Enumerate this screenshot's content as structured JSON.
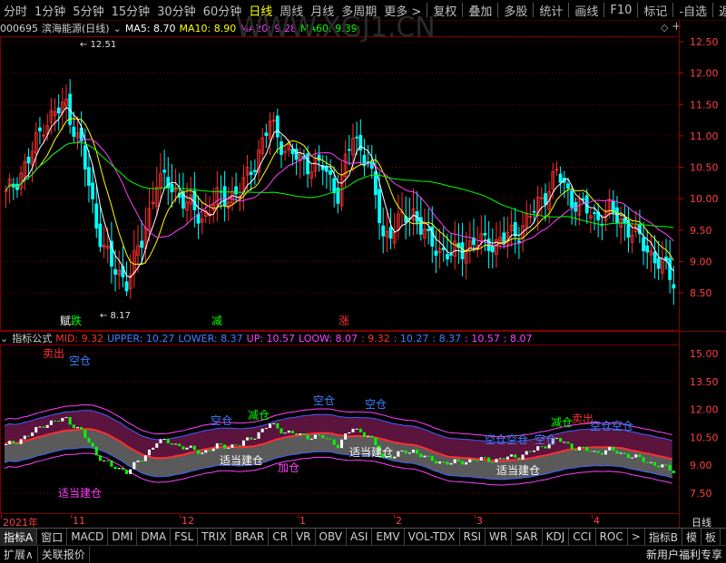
{
  "toolbar": {
    "periods": [
      "分时",
      "1分钟",
      "5分钟",
      "15分钟",
      "30分钟",
      "60分钟",
      "日线",
      "周线",
      "月线",
      "多周期",
      "更多 >"
    ],
    "active_period": "日线",
    "right_items": [
      "复权",
      "叠加",
      "多股",
      "统计",
      "画线",
      "F10",
      "标记",
      "-自选",
      "返回"
    ]
  },
  "stock": {
    "code": "000695",
    "name": "滨海能源(日线)",
    "ma5": "MA5: 8.70",
    "ma10": "MA10: 8.90",
    "ma20": "MA20: 9.28",
    "ma60": "MA60: 9.39",
    "watermark": "WWW.XGJ1.CN"
  },
  "main_axis": {
    "ticks": [
      "12.50",
      "12.00",
      "11.50",
      "11.00",
      "10.50",
      "10.00",
      "9.50",
      "9.00",
      "8.50"
    ],
    "high_mark": "12.51",
    "low_mark": "8.17"
  },
  "main_signals": [
    {
      "text": "赋",
      "color": "#ffffff"
    },
    {
      "text": "跌",
      "color": "#00ff00"
    },
    {
      "text": "减",
      "color": "#00ff00"
    },
    {
      "text": "涨",
      "color": "#ff3030"
    }
  ],
  "indicator": {
    "name": "指标公式",
    "mid": "MID: 9.32",
    "upper": "UPPER: 10.27",
    "lower": "LOWER: 8.37",
    "up": "UP: 10.57",
    "loow": "LOOW: 8.07",
    "v1": ": 9.32",
    "v2": ": 10.27",
    "v3": ": 8.37",
    "v4": ": 10.57",
    "v5": ": 8.07",
    "ticks": [
      "15.00",
      "13.50",
      "12.00",
      "10.50",
      "9.00",
      "7.50"
    ]
  },
  "indicator_labels": [
    {
      "text": "卖出",
      "color": "#ff3030"
    },
    {
      "text": "空仓",
      "color": "#4080ff"
    },
    {
      "text": "适当建仓",
      "color": "#ff40ff"
    },
    {
      "text": "空仓",
      "color": "#4080ff"
    },
    {
      "text": "减仓",
      "color": "#00ff00"
    },
    {
      "text": "适当建仓",
      "color": "#ffffff"
    },
    {
      "text": "加仓",
      "color": "#ff40ff"
    },
    {
      "text": "空仓",
      "color": "#4080ff"
    },
    {
      "text": "适当建仓",
      "color": "#ffffff"
    },
    {
      "text": "空仓",
      "color": "#4080ff"
    },
    {
      "text": "空仓空仓",
      "color": "#4080ff"
    },
    {
      "text": "空仓",
      "color": "#4080ff"
    },
    {
      "text": "适当建仓",
      "color": "#ffffff"
    },
    {
      "text": "减仓",
      "color": "#00ff00"
    },
    {
      "text": "卖出",
      "color": "#ff3030"
    },
    {
      "text": "空仓空仓",
      "color": "#4080ff"
    }
  ],
  "date_axis": [
    "2021年",
    "11",
    "12",
    "1",
    "2",
    "3",
    "4"
  ],
  "date_axis_right": "日线",
  "tabs": [
    "指标A",
    "窗口",
    "MACD",
    "DMI",
    "DMA",
    "FSL",
    "TRIX",
    "BRAR",
    "CR",
    "VR",
    "OBV",
    "ASI",
    "EMV",
    "VOL-TDX",
    "RSI",
    "WR",
    "SAR",
    "KDJ",
    "CCI",
    "ROC",
    ">",
    "指标B",
    "模",
    "板"
  ],
  "status": {
    "left": [
      "扩展∧",
      "关联报价"
    ],
    "right": "新用户福利专享"
  },
  "colors": {
    "up_candle": "#ff3030",
    "down_candle": "#00ffff",
    "ma5": "#ffffff",
    "ma10": "#ffff00",
    "ma20": "#ff40ff",
    "ma60": "#00ff00",
    "grid": "#800000"
  }
}
